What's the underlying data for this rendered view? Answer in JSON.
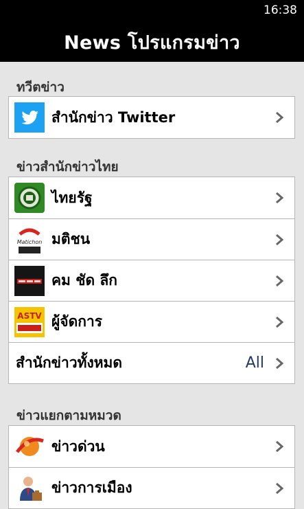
{
  "status_bar": {
    "time": "16:38"
  },
  "header": {
    "title": "News โปรแกรมข่าว"
  },
  "sections": [
    {
      "title": "ทวีตข่าว",
      "items": [
        {
          "label": "สำนักข่าว Twitter",
          "icon": "twitter-icon"
        }
      ]
    },
    {
      "title": "ข่าวสำนักข่าวไทย",
      "items": [
        {
          "label": "ไทยรัฐ",
          "icon": "thairath-logo-icon"
        },
        {
          "label": "มติชน",
          "icon": "matichon-logo-icon",
          "icon_text": "Matichon"
        },
        {
          "label": "คม ชัด ลึก",
          "icon": "komchadluek-logo-icon"
        },
        {
          "label": "ผู้จัดการ",
          "icon": "astv-manager-logo-icon",
          "icon_text": "ASTV"
        },
        {
          "label": "สำนักข่าวทั้งหมด",
          "right_text": "All"
        }
      ]
    },
    {
      "title": "ข่าวแยกตามหมวด",
      "items": [
        {
          "label": "ข่าวด่วน",
          "icon": "breaking-news-icon"
        },
        {
          "label": "ข่าวการเมือง",
          "icon": "politics-icon"
        }
      ]
    }
  ],
  "colors": {
    "background": "#e5e5e5",
    "bar": "#000000",
    "accent_text": "#1d3b6e",
    "twitter": "#1da1f2"
  }
}
